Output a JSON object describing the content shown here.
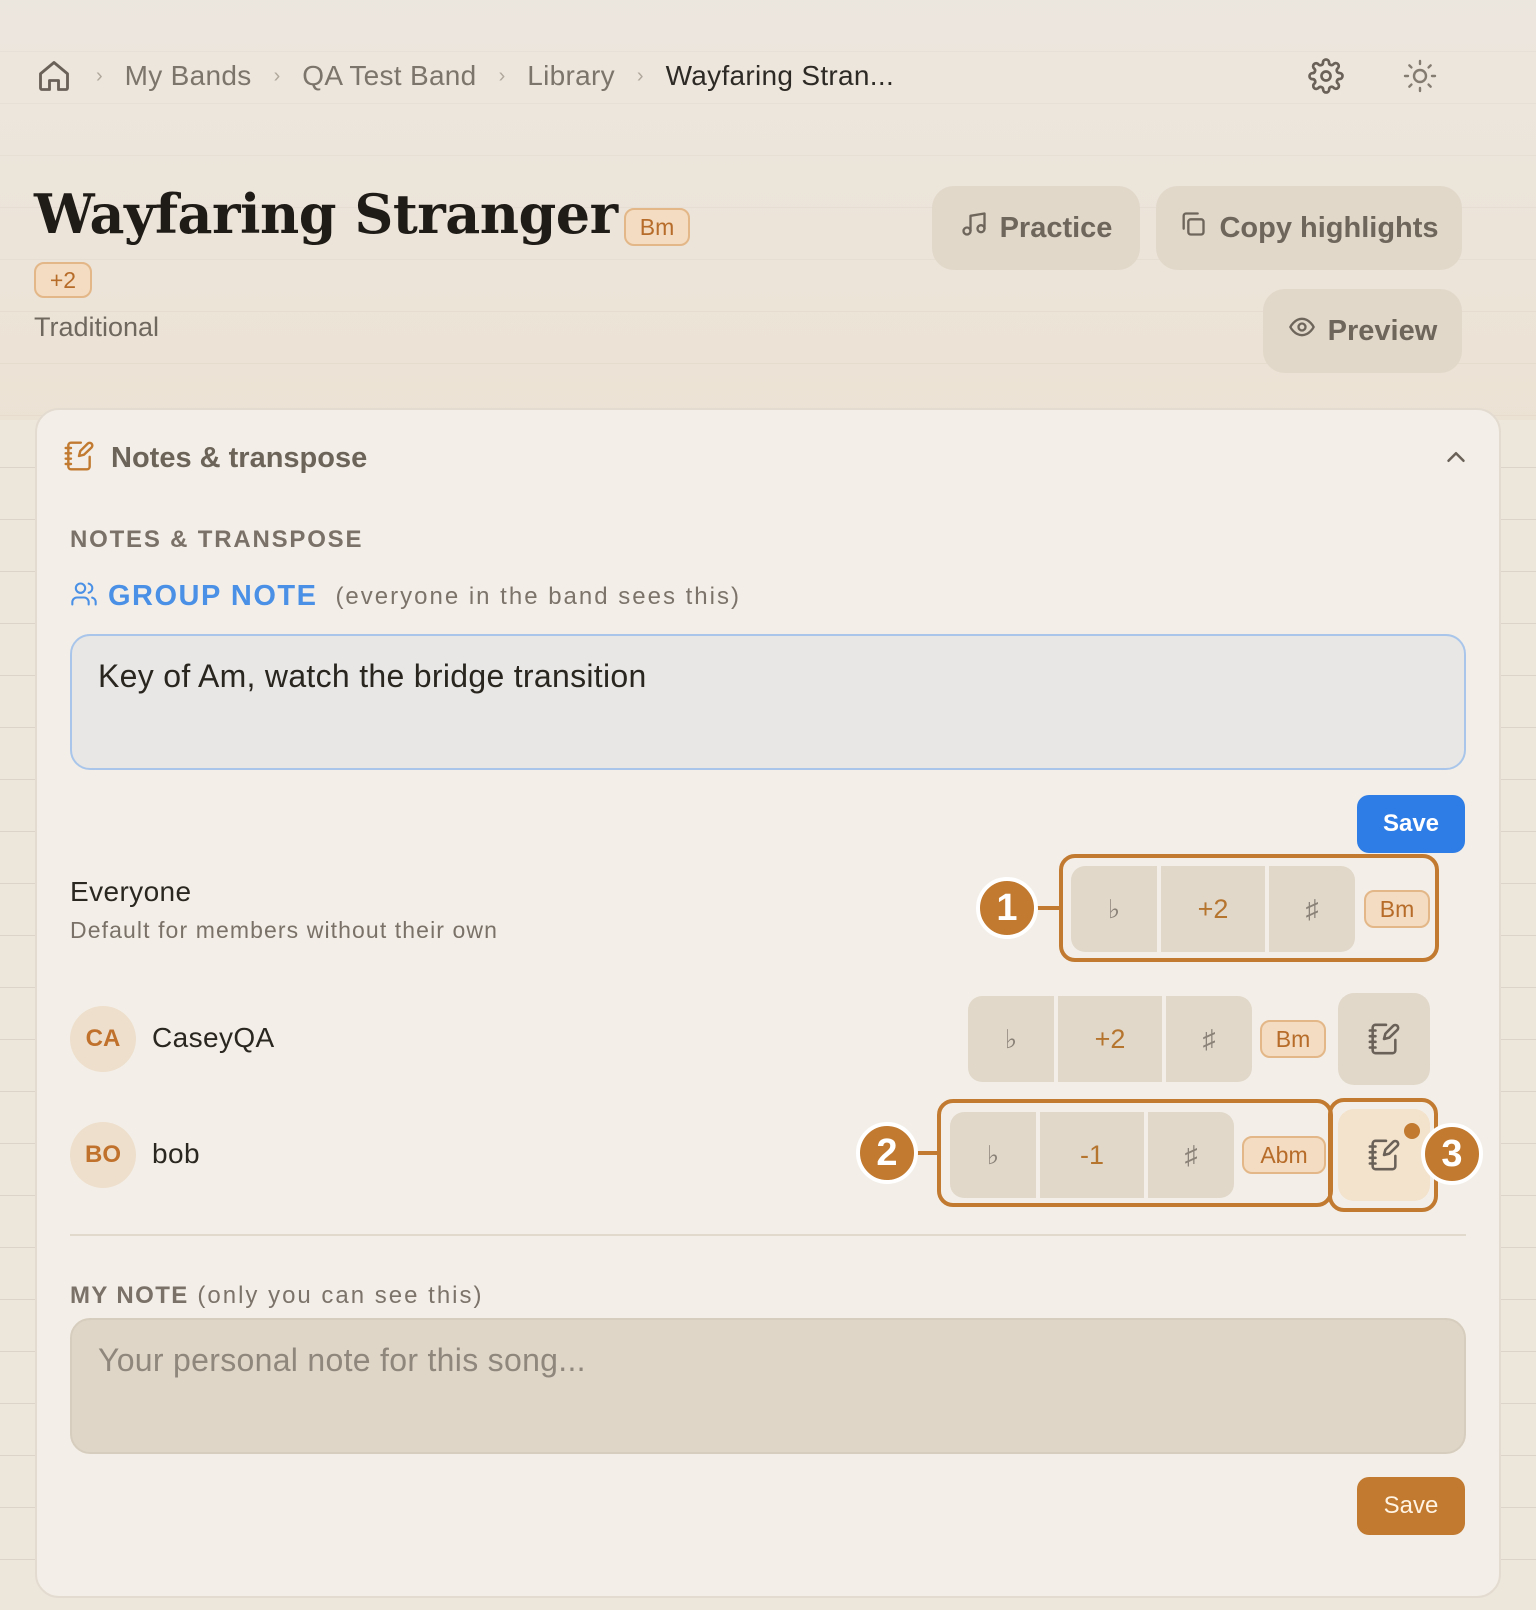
{
  "breadcrumb": {
    "items": [
      "My Bands",
      "QA Test Band",
      "Library",
      "Wayfaring Stran..."
    ]
  },
  "song": {
    "title": "Wayfaring Stranger",
    "key": "Bm",
    "transpose_badge": "+2",
    "artist": "Traditional"
  },
  "actions": {
    "practice": "Practice",
    "copy_highlights": "Copy highlights",
    "preview": "Preview"
  },
  "panel": {
    "header": "Notes & transpose",
    "section_label": "NOTES & TRANSPOSE",
    "group_note_label": "GROUP NOTE",
    "group_note_sub": "(everyone in the band sees this)",
    "group_note_value": "Key of Am, watch the bridge transition",
    "save_group": "Save",
    "my_note_label": "MY NOTE",
    "my_note_sub": "(only you can see this)",
    "my_note_placeholder": "Your personal note for this song...",
    "save_mine": "Save"
  },
  "transpose_rows": [
    {
      "name": "Everyone",
      "subtitle": "Default for members without their own",
      "flat": "♭",
      "value": "+2",
      "sharp": "♯",
      "key": "Bm"
    },
    {
      "initials": "CA",
      "name": "CaseyQA",
      "flat": "♭",
      "value": "+2",
      "sharp": "♯",
      "key": "Bm",
      "has_note": false
    },
    {
      "initials": "BO",
      "name": "bob",
      "flat": "♭",
      "value": "-1",
      "sharp": "♯",
      "key": "Abm",
      "has_note": true
    }
  ],
  "annotations": [
    "1",
    "2",
    "3"
  ],
  "colors": {
    "accent": "#c17a30",
    "primary_blue": "#2e7de6",
    "group_blue": "#4a90e6",
    "background": "#ede6db"
  },
  "icons": {
    "home": "home-icon",
    "settings": "gear-icon",
    "theme": "sun-icon",
    "practice": "music-note-icon",
    "copy": "copy-icon",
    "preview": "eye-icon",
    "notes": "notebook-pen-icon",
    "collapse": "chevron-up-icon",
    "group": "users-icon"
  }
}
